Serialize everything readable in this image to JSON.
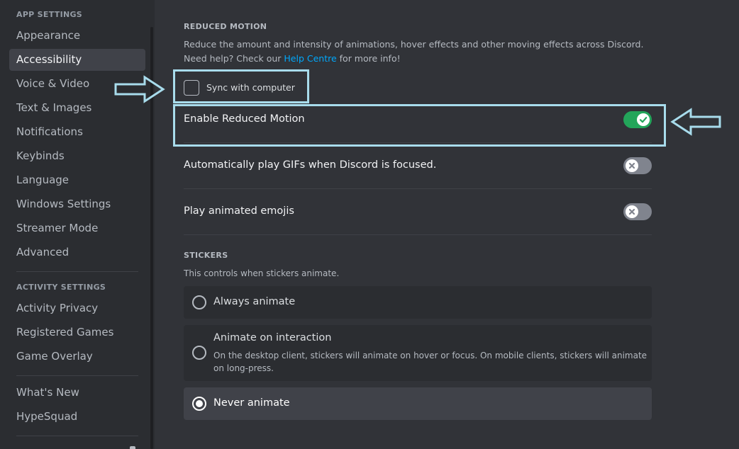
{
  "sidebar": {
    "app_settings_header": "APP SETTINGS",
    "app_items": [
      {
        "label": "Appearance"
      },
      {
        "label": "Accessibility"
      },
      {
        "label": "Voice & Video"
      },
      {
        "label": "Text & Images"
      },
      {
        "label": "Notifications"
      },
      {
        "label": "Keybinds"
      },
      {
        "label": "Language"
      },
      {
        "label": "Windows Settings"
      },
      {
        "label": "Streamer Mode"
      },
      {
        "label": "Advanced"
      }
    ],
    "activity_settings_header": "ACTIVITY SETTINGS",
    "activity_items": [
      {
        "label": "Activity Privacy"
      },
      {
        "label": "Registered Games"
      },
      {
        "label": "Game Overlay"
      }
    ],
    "misc_items": [
      {
        "label": "What's New"
      },
      {
        "label": "HypeSquad"
      }
    ],
    "selected": "Accessibility"
  },
  "reduced_motion": {
    "title": "REDUCED MOTION",
    "description_pre": "Reduce the amount and intensity of animations, hover effects and other moving effects across Discord. Need help? Check our ",
    "link_text": "Help Centre",
    "description_post": " for more info!",
    "sync_label": "Sync with computer",
    "sync_checked": false,
    "rows": [
      {
        "label": "Enable Reduced Motion",
        "enabled": true
      },
      {
        "label": "Automatically play GIFs when Discord is focused.",
        "enabled": false
      },
      {
        "label": "Play animated emojis",
        "enabled": false
      }
    ]
  },
  "stickers": {
    "title": "STICKERS",
    "description": "This controls when stickers animate.",
    "options": [
      {
        "label": "Always animate",
        "description": "",
        "selected": false
      },
      {
        "label": "Animate on interaction",
        "description": "On the desktop client, stickers will animate on hover or focus. On mobile clients, stickers will animate on long-press.",
        "selected": false
      },
      {
        "label": "Never animate",
        "description": "",
        "selected": true
      }
    ]
  },
  "colors": {
    "accent_link": "#00a8fc",
    "toggle_on": "#23a55a",
    "toggle_off": "#80848e",
    "annotation": "#a8dcec"
  },
  "icons": {
    "toggle_on": "check-icon",
    "toggle_off": "x-icon",
    "annotation_arrows": "arrow-icon"
  }
}
